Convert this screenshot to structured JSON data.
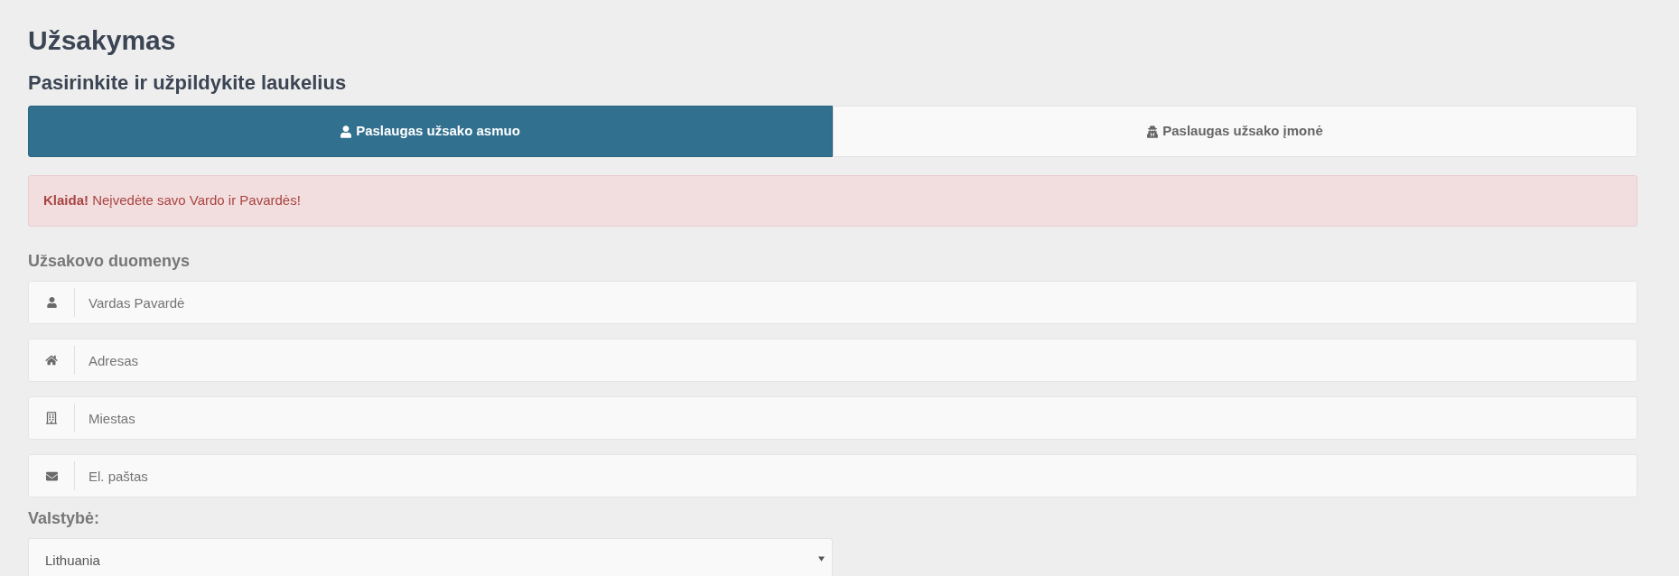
{
  "page": {
    "title": "Užsakymas",
    "subtitle": "Pasirinkite ir užpildykite laukelius"
  },
  "tabs": [
    {
      "label": "Paslaugas užsako asmuo",
      "selected": true
    },
    {
      "label": "Paslaugas užsako įmonė",
      "selected": false
    }
  ],
  "alert": {
    "text": "**Klaida!** Neįvedėte savo Vardo ir Pavardės!"
  },
  "customer_data": {
    "title": "Užsakovo duomenys",
    "fields": [
      {
        "placeholder": "Vardas Pavardė"
      },
      {
        "placeholder": "Adresas"
      },
      {
        "placeholder": "Miestas"
      },
      {
        "placeholder": "El. paštas"
      }
    ]
  },
  "country": {
    "label": "Valstybė:",
    "value": "Lithuania"
  }
}
